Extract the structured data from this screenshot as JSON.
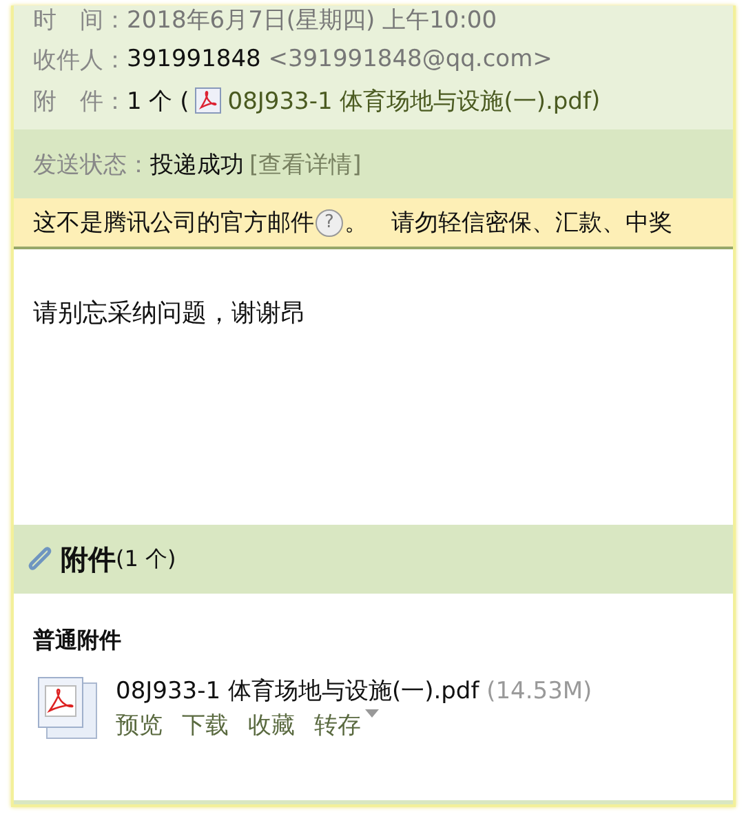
{
  "header": {
    "fields": [
      {
        "kind": "time",
        "label": "时　间：",
        "value": "2018年6月7日(星期四) 上午10:00"
      },
      {
        "kind": "recipient",
        "label": "收件人：",
        "name": "391991848",
        "email": "<391991848@qq.com>"
      },
      {
        "kind": "attachment",
        "label": "附　件：",
        "count": "1 个 (",
        "file": "08J933-1 体育场地与设施(一).pdf",
        "close": ")"
      }
    ]
  },
  "status": {
    "label": "发送状态：",
    "value": "投递成功",
    "details": "[查看详情]"
  },
  "warning": {
    "text": "这不是腾讯公司的官方邮件",
    "help": "?",
    "rest": "。　请勿轻信密保、汇款、中奖"
  },
  "body": {
    "text": "请别忘采纳问题，谢谢昂"
  },
  "attachments": {
    "title": "附件",
    "count": "(1 个)",
    "group": "普通附件",
    "files": [
      {
        "name": "08J933-1 体育场地与设施(一).pdf",
        "size": "(14.53M)",
        "actions": [
          "预览",
          "下载",
          "收藏",
          "转存"
        ]
      }
    ]
  }
}
